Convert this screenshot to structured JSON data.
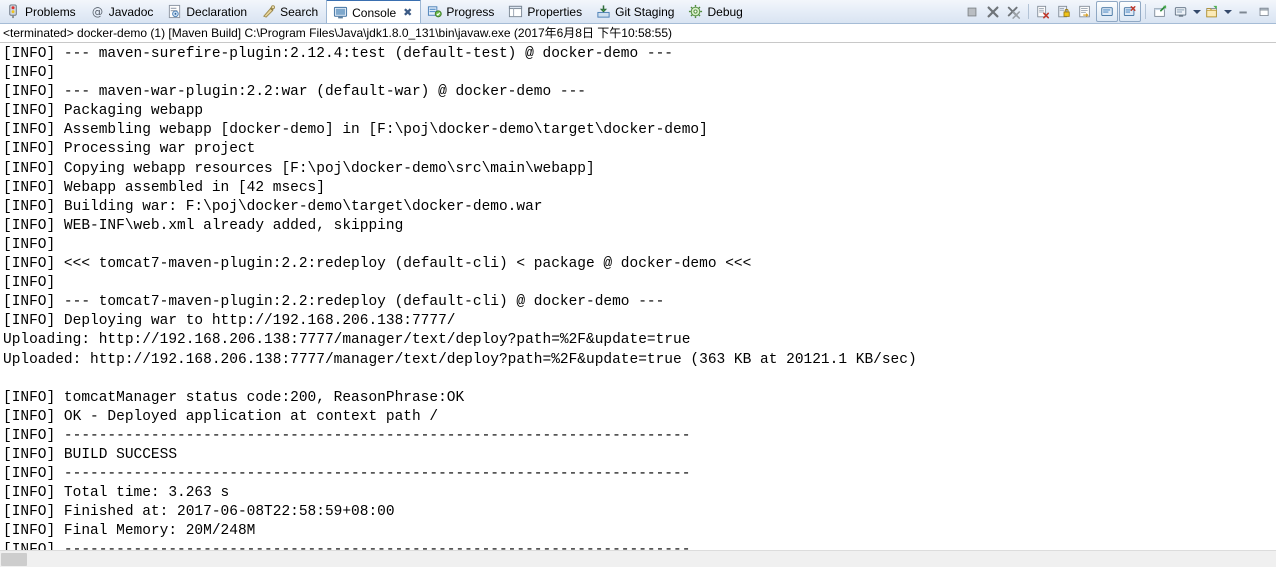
{
  "tabs": [
    {
      "label": "Problems",
      "icon": "problems-icon",
      "active": false,
      "closable": false
    },
    {
      "label": "Javadoc",
      "icon": "javadoc-icon",
      "active": false,
      "closable": false
    },
    {
      "label": "Declaration",
      "icon": "declaration-icon",
      "active": false,
      "closable": false
    },
    {
      "label": "Search",
      "icon": "search-icon",
      "active": false,
      "closable": false
    },
    {
      "label": "Console",
      "icon": "console-icon",
      "active": true,
      "closable": true,
      "close_glyph": "✖"
    },
    {
      "label": "Progress",
      "icon": "progress-icon",
      "active": false,
      "closable": false
    },
    {
      "label": "Properties",
      "icon": "properties-icon",
      "active": false,
      "closable": false
    },
    {
      "label": "Git Staging",
      "icon": "git-staging-icon",
      "active": false,
      "closable": false
    },
    {
      "label": "Debug",
      "icon": "debug-icon",
      "active": false,
      "closable": false
    }
  ],
  "toolbar": {
    "buttons": [
      {
        "name": "terminate-button",
        "glyph": "terminate"
      },
      {
        "name": "remove-launch-button",
        "glyph": "remove-launch"
      },
      {
        "name": "remove-all-launches-button",
        "glyph": "remove-all-launches"
      },
      {
        "name": "clear-console-button",
        "glyph": "clear-console"
      },
      {
        "name": "scroll-lock-button",
        "glyph": "scroll-lock"
      },
      {
        "name": "word-wrap-button",
        "glyph": "word-wrap"
      },
      {
        "name": "show-console-on-output-button",
        "glyph": "show-on-output"
      },
      {
        "name": "show-console-on-error-button",
        "glyph": "show-on-error"
      },
      {
        "name": "pin-console-button",
        "glyph": "pin-console"
      },
      {
        "name": "display-selected-console-button",
        "glyph": "display-console"
      },
      {
        "name": "open-console-button",
        "glyph": "open-console"
      },
      {
        "name": "minimize-view-button",
        "glyph": "minimize"
      },
      {
        "name": "maximize-view-button",
        "glyph": "maximize"
      }
    ]
  },
  "process": {
    "status_line": "<terminated> docker-demo (1) [Maven Build] C:\\Program Files\\Java\\jdk1.8.0_131\\bin\\javaw.exe (2017年6月8日 下午10:58:55)"
  },
  "console": {
    "lines": [
      "[INFO] --- maven-surefire-plugin:2.12.4:test (default-test) @ docker-demo ---",
      "[INFO]",
      "[INFO] --- maven-war-plugin:2.2:war (default-war) @ docker-demo ---",
      "[INFO] Packaging webapp",
      "[INFO] Assembling webapp [docker-demo] in [F:\\poj\\docker-demo\\target\\docker-demo]",
      "[INFO] Processing war project",
      "[INFO] Copying webapp resources [F:\\poj\\docker-demo\\src\\main\\webapp]",
      "[INFO] Webapp assembled in [42 msecs]",
      "[INFO] Building war: F:\\poj\\docker-demo\\target\\docker-demo.war",
      "[INFO] WEB-INF\\web.xml already added, skipping",
      "[INFO]",
      "[INFO] <<< tomcat7-maven-plugin:2.2:redeploy (default-cli) < package @ docker-demo <<<",
      "[INFO]",
      "[INFO] --- tomcat7-maven-plugin:2.2:redeploy (default-cli) @ docker-demo ---",
      "[INFO] Deploying war to http://192.168.206.138:7777/",
      "Uploading: http://192.168.206.138:7777/manager/text/deploy?path=%2F&update=true",
      "Uploaded: http://192.168.206.138:7777/manager/text/deploy?path=%2F&update=true (363 KB at 20121.1 KB/sec)",
      "",
      "[INFO] tomcatManager status code:200, ReasonPhrase:OK",
      "[INFO] OK - Deployed application at context path /",
      "[INFO] ------------------------------------------------------------------------",
      "[INFO] BUILD SUCCESS",
      "[INFO] ------------------------------------------------------------------------",
      "[INFO] Total time: 3.263 s",
      "[INFO] Finished at: 2017-06-08T22:58:59+08:00",
      "[INFO] Final Memory: 20M/248M",
      "[INFO] ------------------------------------------------------------------------"
    ]
  },
  "colors": {
    "console_text": "#000000",
    "tab_active_border": "#3a6fb0",
    "tabbar_background": "#e4ecf7",
    "console_background": "#ffffff"
  }
}
